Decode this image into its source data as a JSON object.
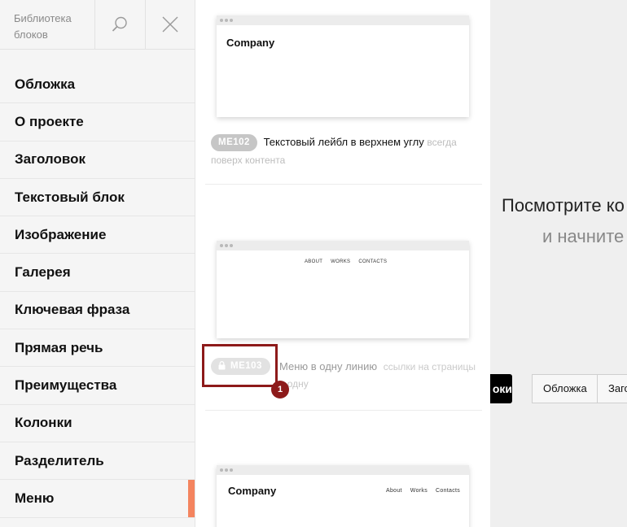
{
  "sidebar": {
    "title": "Библиотека блоков",
    "items": [
      {
        "label": "Обложка"
      },
      {
        "label": "О проекте"
      },
      {
        "label": "Заголовок"
      },
      {
        "label": "Текстовый блок"
      },
      {
        "label": "Изображение"
      },
      {
        "label": "Галерея"
      },
      {
        "label": "Ключевая фраза"
      },
      {
        "label": "Прямая речь"
      },
      {
        "label": "Преимущества"
      },
      {
        "label": "Колонки"
      },
      {
        "label": "Разделитель"
      },
      {
        "label": "Меню",
        "active": true
      }
    ]
  },
  "blocks": [
    {
      "code": "ME102",
      "title": "Текстовый лейбл в верхнем углу",
      "subtitle_a": "всегда",
      "subtitle_b": "поверх контента",
      "preview": {
        "company": "Company"
      }
    },
    {
      "code": "ME103",
      "title": "Меню в одну линию",
      "subtitle_a": "ссылки на страницы",
      "subtitle_b": "в одну",
      "locked": true,
      "preview": {
        "nav": [
          "ABOUT",
          "WORKS",
          "CONTACTS"
        ]
      }
    },
    {
      "preview": {
        "company": "Company",
        "nav": [
          "About",
          "Works",
          "Contacts"
        ]
      }
    }
  ],
  "annotation": {
    "number": "1",
    "color": "#8d1a1a"
  },
  "right": {
    "heading_line1": "Посмотрите ко",
    "heading_line2": "и начните",
    "dark_button": "оки",
    "chips": [
      "Обложка",
      "Заго"
    ]
  },
  "colors": {
    "accent": "#f4845f",
    "highlight": "#8d1a1a",
    "badge": "#c6c6c6"
  }
}
